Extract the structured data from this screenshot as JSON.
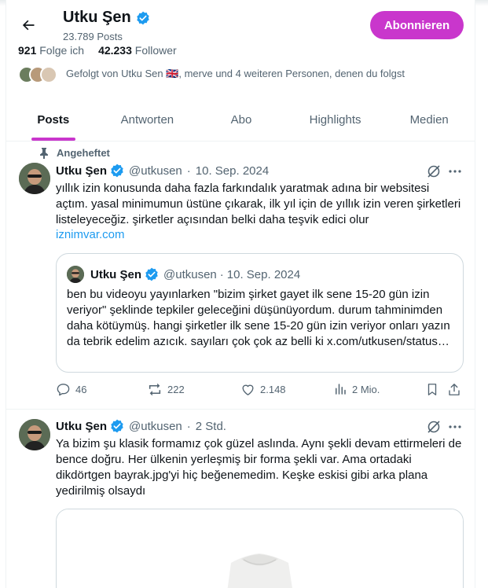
{
  "header": {
    "name": "Utku Şen",
    "post_count": "23.789 Posts",
    "subscribe_label": "Abonnieren",
    "following_count": "921",
    "following_label": "Folge ich",
    "followers_count": "42.233",
    "followers_label": "Follower",
    "followed_by_text": "Gefolgt von Utku Sen 🇬🇧, merve und 4 weiteren Personen, denen du folgst"
  },
  "tabs": [
    {
      "label": "Posts",
      "active": true
    },
    {
      "label": "Antworten",
      "active": false
    },
    {
      "label": "Abo",
      "active": false
    },
    {
      "label": "Highlights",
      "active": false
    },
    {
      "label": "Medien",
      "active": false
    }
  ],
  "posts": [
    {
      "pinned_label": "Angeheftet",
      "name": "Utku Şen",
      "handle": "@utkusen",
      "sep": "·",
      "date": "10. Sep. 2024",
      "text": "yıllık izin konusunda daha fazla farkındalık yaratmak adına bir websitesi açtım. yasal minimumun üstüne çıkarak, ilk yıl için de yıllık izin veren şirketleri listeleyeceğiz. şirketler açısından belki daha teşvik edici olur",
      "link": "iznimvar.com",
      "quote": {
        "name": "Utku Şen",
        "handle": "@utkusen",
        "sep": "·",
        "date": "10. Sep. 2024",
        "text": "ben bu videoyu yayınlarken \"bizim şirket gayet ilk sene 15-20 gün izin veriyor\" şeklinde tepkiler geleceğini düşünüyordum. durum tahminimden daha kötüymüş. hangi şirketler ilk sene 15-20 gün izin veriyor onları yazın da tebrik edelim azıcık. sayıları çok çok az belli ki x.com/utkusen/status…"
      },
      "replies": "46",
      "reposts": "222",
      "likes": "2.148",
      "views": "2 Mio."
    },
    {
      "name": "Utku Şen",
      "handle": "@utkusen",
      "sep": "·",
      "date": "2 Std.",
      "text": "Ya bizim şu klasik formamız çok güzel aslında. Aynı şekli devam ettirmeleri de bence doğru. Her ülkenin yerleşmiş bir forma şekli var. Ama ortadaki dikdörtgen bayrak.jpg'yi hiç beğenemedim. Keşke eskisi gibi arka plana yedirilmiş olsaydı"
    }
  ],
  "colors": {
    "accent": "#c936cc",
    "link": "#1d9bf0",
    "verified": "#1d9bf0",
    "secondary_text": "#536471"
  }
}
